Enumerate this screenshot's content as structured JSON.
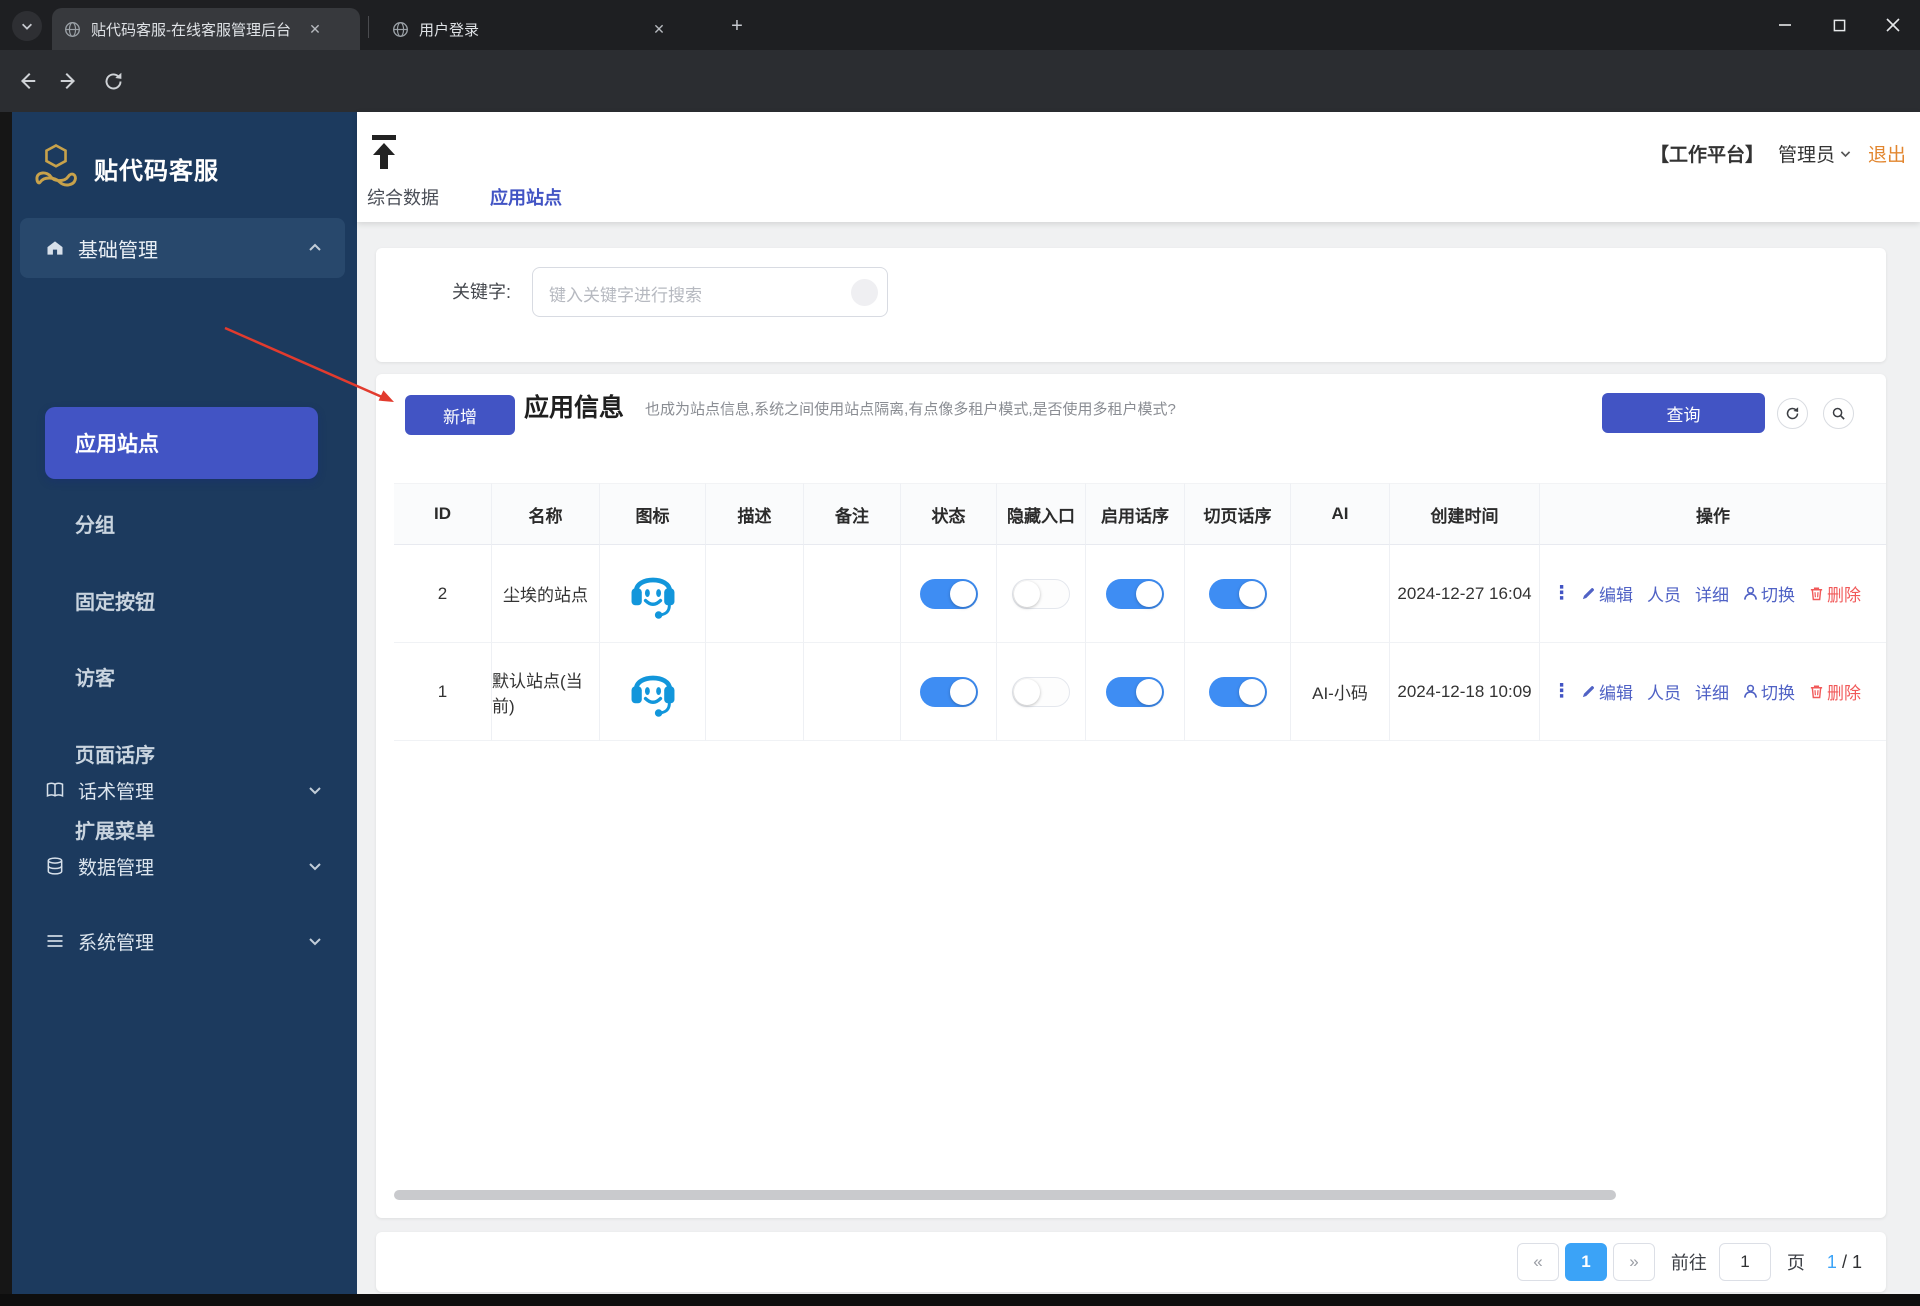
{
  "browser": {
    "tab1": "贴代码客服-在线客服管理后台",
    "tab2": "用户登录",
    "url": "speak.pastecode.cn/page/index.html"
  },
  "sidebar": {
    "logo": "贴代码客服",
    "group1": {
      "label": "基础管理",
      "active": "应用站点",
      "items": [
        "应用站点",
        "分组",
        "固定按钮",
        "访客",
        "页面话序",
        "扩展菜单"
      ]
    },
    "group2": {
      "label": "话术管理"
    },
    "group3": {
      "label": "数据管理"
    },
    "group4": {
      "label": "系统管理"
    }
  },
  "topbar": {
    "tab_overview": "综合数据",
    "tab_sites": "应用站点",
    "workspace": "【工作平台】",
    "user": "管理员",
    "logout": "退出"
  },
  "filter": {
    "label": "关键字:",
    "placeholder": "键入关键字进行搜索"
  },
  "toolbar": {
    "add": "新增",
    "title": "应用信息",
    "subtitle": "也成为站点信息,系统之间使用站点隔离,有点像多租户模式,是否使用多租户模式?",
    "query": "查询"
  },
  "table": {
    "columns": [
      "ID",
      "名称",
      "图标",
      "描述",
      "备注",
      "状态",
      "隐藏入口",
      "启用话序",
      "切页话序",
      "AI",
      "创建时间",
      "操作"
    ],
    "rows": [
      {
        "id": "2",
        "name": "尘埃的站点",
        "desc": "",
        "note": "",
        "toggles": [
          true,
          false,
          true,
          true
        ],
        "ai": "",
        "created": "2024-12-27 16:04",
        "actions": [
          "编辑",
          "人员",
          "详细",
          "切换",
          "删除"
        ]
      },
      {
        "id": "1",
        "name": "默认站点(当前)",
        "desc": "",
        "note": "",
        "toggles": [
          true,
          false,
          true,
          true
        ],
        "ai": "AI-小码",
        "created": "2024-12-18 10:09",
        "actions": [
          "编辑",
          "人员",
          "详细",
          "切换",
          "删除"
        ]
      }
    ]
  },
  "pagination": {
    "prev": "«",
    "page": "1",
    "next": "»",
    "goto_label": "前往",
    "goto_value": "1",
    "unit": "页",
    "current": "1",
    "sep": "/",
    "total": "1"
  },
  "colors": {
    "accent": "#4254c4",
    "toggle_on": "#3e8df3",
    "logout": "#e2862f",
    "delete": "#f15959",
    "page_active": "#3ba3f7",
    "annotation": "#e23b2e"
  }
}
